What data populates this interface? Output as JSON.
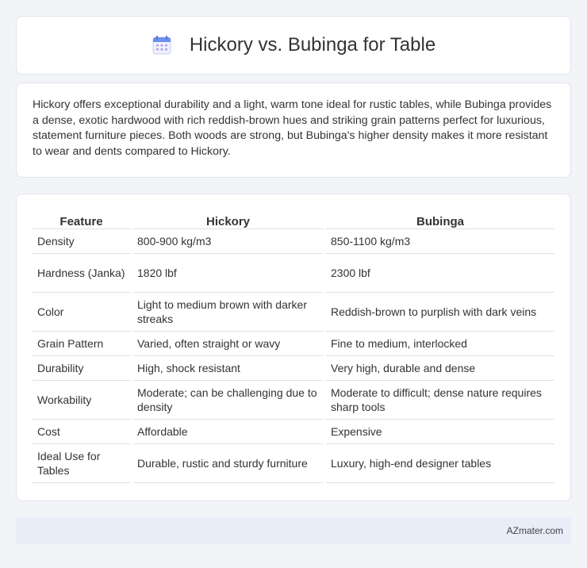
{
  "header": {
    "title": "Hickory vs. Bubinga for Table",
    "icon": "calendar-icon"
  },
  "description": "Hickory offers exceptional durability and a light, warm tone ideal for rustic tables, while Bubinga provides a dense, exotic hardwood with rich reddish-brown hues and striking grain patterns perfect for luxurious, statement furniture pieces. Both woods are strong, but Bubinga's higher density makes it more resistant to wear and dents compared to Hickory.",
  "table": {
    "headers": [
      "Feature",
      "Hickory",
      "Bubinga"
    ],
    "rows": [
      [
        "Density",
        "800-900 kg/m3",
        "850-1100 kg/m3"
      ],
      [
        "Hardness (Janka)",
        "1820 lbf",
        "2300 lbf"
      ],
      [
        "Color",
        "Light to medium brown with darker streaks",
        "Reddish-brown to purplish with dark veins"
      ],
      [
        "Grain Pattern",
        "Varied, often straight or wavy",
        "Fine to medium, interlocked"
      ],
      [
        "Durability",
        "High, shock resistant",
        "Very high, durable and dense"
      ],
      [
        "Workability",
        "Moderate; can be challenging due to density",
        "Moderate to difficult; dense nature requires sharp tools"
      ],
      [
        "Cost",
        "Affordable",
        "Expensive"
      ],
      [
        "Ideal Use for Tables",
        "Durable, rustic and sturdy furniture",
        "Luxury, high-end designer tables"
      ]
    ]
  },
  "footer": {
    "text": "AZmater.com"
  }
}
